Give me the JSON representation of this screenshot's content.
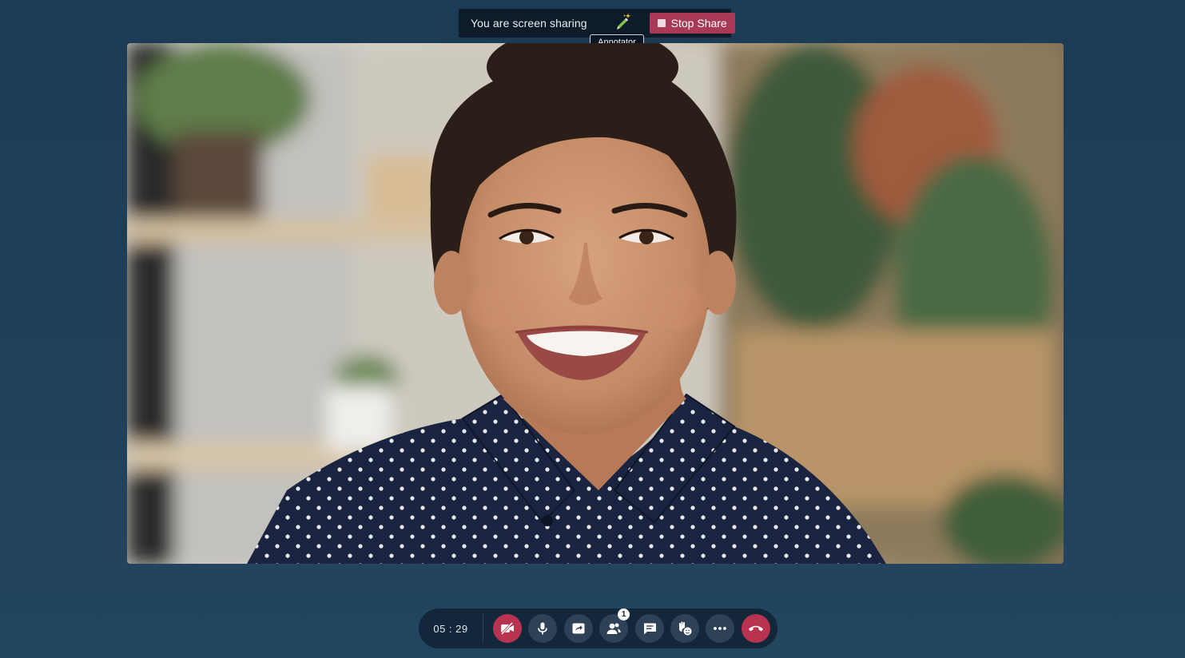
{
  "share_banner": {
    "message": "You are screen sharing",
    "annotator_icon": "pencil-sparkle-icon",
    "annotator_tooltip": "Annotator",
    "stop_share_label": "Stop Share",
    "stop_share_color": "#a83a55"
  },
  "video": {
    "content": "participant-video-smiling-woman"
  },
  "controls": {
    "timer": "05 : 29",
    "buttons": [
      {
        "name": "video-off-button",
        "icon": "video-off-icon",
        "color": "#b8334f"
      },
      {
        "name": "microphone-button",
        "icon": "microphone-icon"
      },
      {
        "name": "share-screen-button",
        "icon": "share-screen-icon"
      },
      {
        "name": "participants-button",
        "icon": "participants-icon",
        "badge": "1"
      },
      {
        "name": "chat-button",
        "icon": "chat-icon"
      },
      {
        "name": "reactions-button",
        "icon": "raise-hand-emoji-icon"
      },
      {
        "name": "more-options-button",
        "icon": "more-dots-icon"
      },
      {
        "name": "end-call-button",
        "icon": "hang-up-icon",
        "color": "#b8334f"
      }
    ]
  }
}
